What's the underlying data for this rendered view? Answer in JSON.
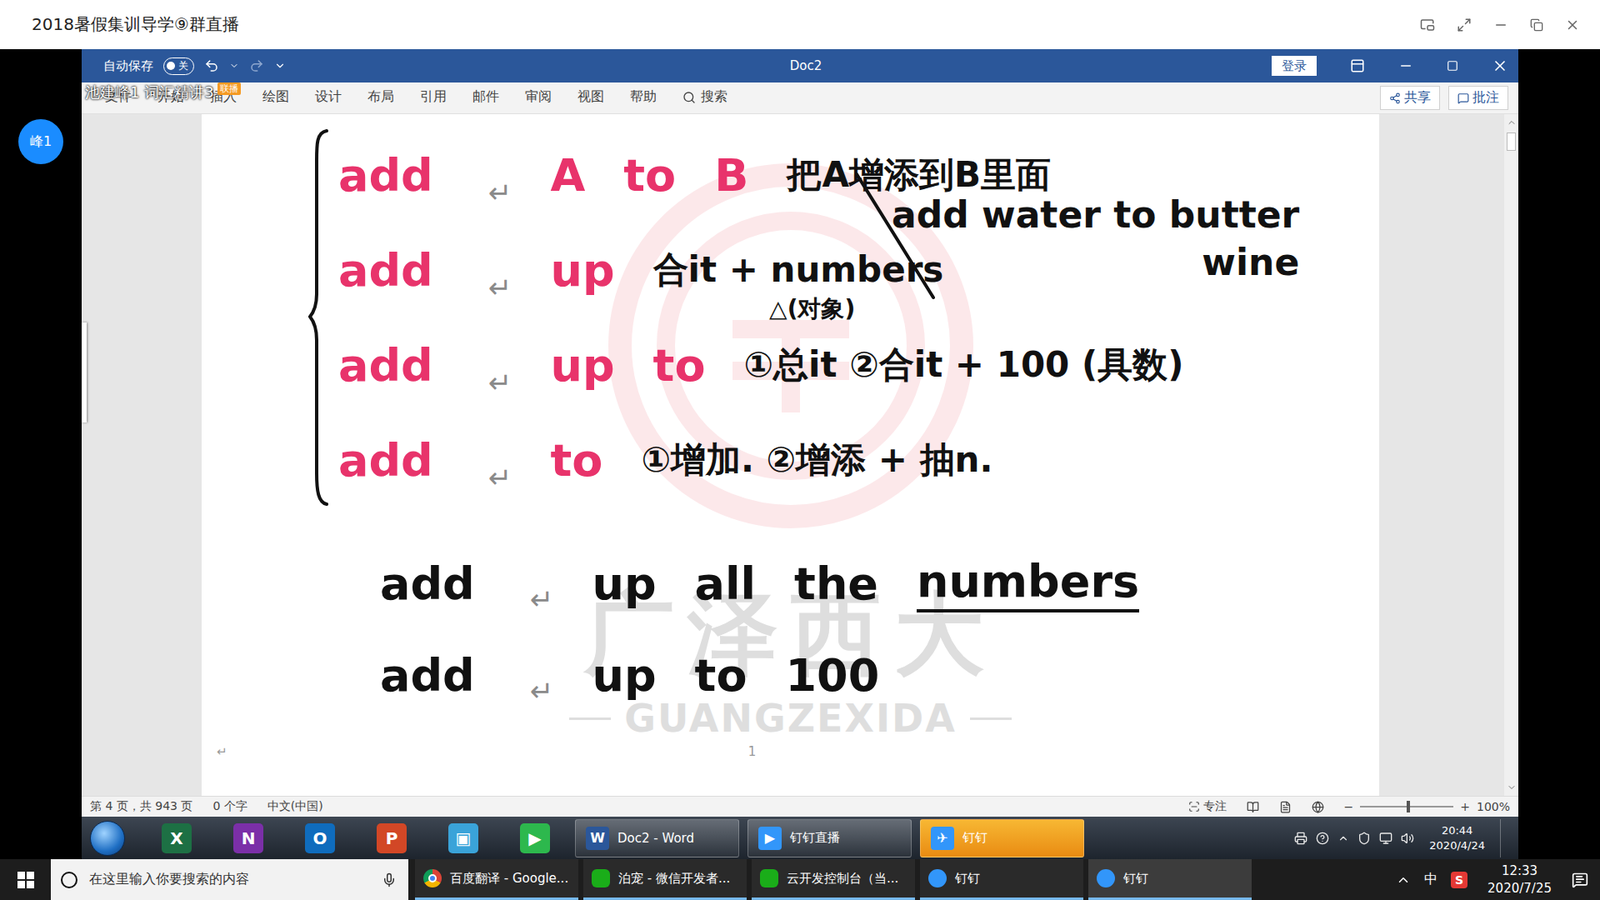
{
  "live_window": {
    "title": "2018暑假集训导学⑨群直播",
    "presenter": "峰1"
  },
  "stream_overlay": {
    "caption": "池建峰1 词汇精讲3",
    "badge": "联播"
  },
  "word": {
    "autosave": {
      "label": "自动保存",
      "state_text": "关",
      "on": false
    },
    "doc_title": "Doc2",
    "login": "登录",
    "tabs": [
      {
        "label": "文件",
        "selected": false
      },
      {
        "label": "开始",
        "selected": false
      },
      {
        "label": "插入",
        "selected": false
      },
      {
        "label": "绘图",
        "selected": false
      },
      {
        "label": "设计",
        "selected": false
      },
      {
        "label": "布局",
        "selected": false
      },
      {
        "label": "引用",
        "selected": false
      },
      {
        "label": "邮件",
        "selected": false
      },
      {
        "label": "审阅",
        "selected": false
      },
      {
        "label": "视图",
        "selected": false
      },
      {
        "label": "帮助",
        "selected": false
      }
    ],
    "search": "搜索",
    "share": "共享",
    "comment": "批注"
  },
  "notes": {
    "braced_rows": [
      {
        "segments": [
          {
            "text": "add",
            "kind": "word",
            "color": "#e8336b",
            "underlined": false
          },
          {
            "text": "↵",
            "kind": "mark",
            "color": "#8a8a8a",
            "underlined": false
          },
          {
            "text": "A",
            "kind": "word",
            "color": "#e8336b",
            "underlined": false
          },
          {
            "text": "to",
            "kind": "word",
            "color": "#e8336b",
            "underlined": false
          },
          {
            "text": "B",
            "kind": "word",
            "color": "#e8336b",
            "underlined": false
          },
          {
            "text": "把A增添到B里面",
            "kind": "note",
            "color": "#111111",
            "underlined": false
          }
        ]
      },
      {
        "segments": [
          {
            "text": "add",
            "kind": "word",
            "color": "#e8336b",
            "underlined": false
          },
          {
            "text": "↵",
            "kind": "mark",
            "color": "#8a8a8a",
            "underlined": false
          },
          {
            "text": "up",
            "kind": "word",
            "color": "#e8336b",
            "underlined": false
          },
          {
            "text": "合it + numbers",
            "kind": "note",
            "color": "#111111",
            "underlined": false
          }
        ],
        "subnote": "△(对象)"
      },
      {
        "segments": [
          {
            "text": "add",
            "kind": "word",
            "color": "#e8336b",
            "underlined": false
          },
          {
            "text": "↵",
            "kind": "mark",
            "color": "#8a8a8a",
            "underlined": false
          },
          {
            "text": "up",
            "kind": "word",
            "color": "#e8336b",
            "underlined": false
          },
          {
            "text": "to",
            "kind": "word",
            "color": "#e8336b",
            "underlined": false
          },
          {
            "text": "①总it ②合it + 100 (具数)",
            "kind": "note",
            "color": "#111111",
            "underlined": false
          }
        ]
      },
      {
        "segments": [
          {
            "text": "add",
            "kind": "word",
            "color": "#e8336b",
            "underlined": false
          },
          {
            "text": "↵",
            "kind": "mark",
            "color": "#8a8a8a",
            "underlined": false
          },
          {
            "text": "to",
            "kind": "word",
            "color": "#e8336b",
            "underlined": false
          },
          {
            "text": "①增加. ②增添 + 抽n.",
            "kind": "note",
            "color": "#111111",
            "underlined": false
          }
        ]
      }
    ],
    "rows": [
      {
        "segments": [
          {
            "text": "add",
            "kind": "word",
            "color": "#111111",
            "underlined": false
          },
          {
            "text": "↵",
            "kind": "mark",
            "color": "#8a8a8a",
            "underlined": false
          },
          {
            "text": "up",
            "kind": "word",
            "color": "#111111",
            "underlined": false
          },
          {
            "text": "all",
            "kind": "word",
            "color": "#111111",
            "underlined": false
          },
          {
            "text": "the",
            "kind": "word",
            "color": "#111111",
            "underlined": false
          },
          {
            "text": "numbers",
            "kind": "word",
            "color": "#111111",
            "underlined": true
          }
        ]
      },
      {
        "segments": [
          {
            "text": "add",
            "kind": "word",
            "color": "#111111",
            "underlined": false
          },
          {
            "text": "↵",
            "kind": "mark",
            "color": "#8a8a8a",
            "underlined": false
          },
          {
            "text": "up",
            "kind": "word",
            "color": "#111111",
            "underlined": false
          },
          {
            "text": "to",
            "kind": "word",
            "color": "#111111",
            "underlined": false
          },
          {
            "text": "100",
            "kind": "word",
            "color": "#111111",
            "underlined": false
          }
        ]
      }
    ],
    "aside": [
      "add water to butter",
      "wine"
    ],
    "paragraph_mark": "↵",
    "page_number": "1"
  },
  "watermark": {
    "title": "广泽西大",
    "subtitle": "GUANGZEXIDA"
  },
  "status_bar": {
    "items": [
      "第 4 页，共 943 页",
      "0 个字",
      "中文(中国)"
    ],
    "focus": "专注",
    "zoom_out": "−",
    "zoom_in": "+",
    "zoom": "100%",
    "zoom_level": 0.5
  },
  "inner_taskbar": {
    "pinned": [
      {
        "glyph": "X",
        "color": "#1d7044"
      },
      {
        "glyph": "N",
        "color": "#7b2fa8"
      },
      {
        "glyph": "O",
        "color": "#0f6cbd"
      },
      {
        "glyph": "P",
        "color": "#d24726"
      },
      {
        "glyph": "▣",
        "color": "#3aa3d9"
      },
      {
        "glyph": "▶",
        "color": "#2db84d"
      }
    ],
    "tasks": [
      {
        "label": "Doc2 - Word",
        "glyph": "W",
        "color": "#2b579a",
        "selected": false
      },
      {
        "label": "钉钉直播",
        "glyph": "▶",
        "color": "#3296fa",
        "selected": false
      },
      {
        "label": "钉钉",
        "glyph": "✈",
        "color": "#3296fa",
        "selected": true
      }
    ],
    "time": "20:44",
    "date": "2020/4/24"
  },
  "taskbar": {
    "search_placeholder": "在这里输入你要搜索的内容",
    "tasks": [
      {
        "label": "百度翻译 - Google...",
        "kind": "chrome",
        "selected": false
      },
      {
        "label": "泊宠 - 微信开发者...",
        "kind": "wechat",
        "selected": false
      },
      {
        "label": "云开发控制台（当...",
        "kind": "wechat",
        "selected": false
      },
      {
        "label": "钉钉",
        "kind": "dingtalk",
        "selected": false
      },
      {
        "label": "钉钉",
        "kind": "dingtalk",
        "selected": true
      }
    ],
    "ime": "中",
    "ime_logo": "S",
    "time": "12:33",
    "date": "2020/7/25"
  }
}
